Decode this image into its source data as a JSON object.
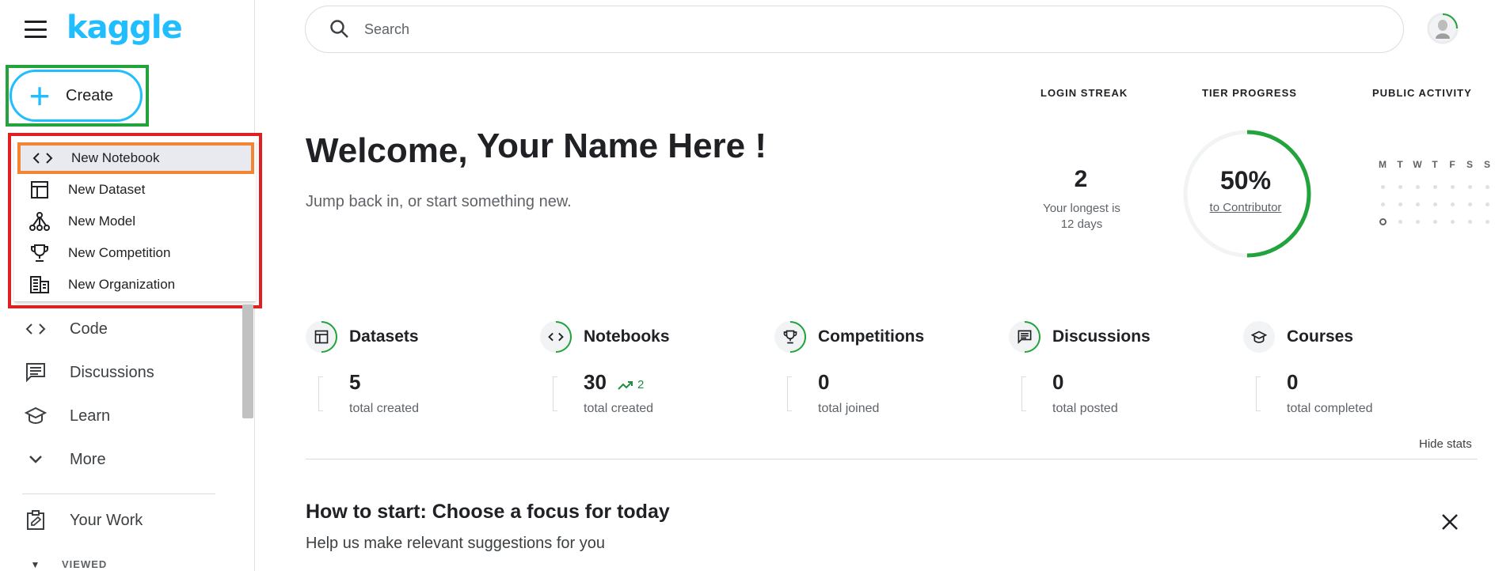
{
  "logo": "kaggle",
  "create_label": "Create",
  "create_menu": [
    {
      "label": "New Notebook",
      "icon": "code-icon"
    },
    {
      "label": "New Dataset",
      "icon": "table-icon"
    },
    {
      "label": "New Model",
      "icon": "model-icon"
    },
    {
      "label": "New Competition",
      "icon": "trophy-icon"
    },
    {
      "label": "New Organization",
      "icon": "building-icon"
    }
  ],
  "nav": [
    {
      "label": "Code",
      "icon": "code-icon"
    },
    {
      "label": "Discussions",
      "icon": "comment-icon"
    },
    {
      "label": "Learn",
      "icon": "school-icon"
    },
    {
      "label": "More",
      "icon": "chevron-down-icon"
    },
    {
      "label": "Your Work",
      "icon": "clipboard-edit-icon"
    }
  ],
  "viewed_label": "VIEWED",
  "search": {
    "placeholder": "Search"
  },
  "welcome": {
    "prefix": "Welcome,",
    "name": "Your Name Here !",
    "subtitle": "Jump back in, or start something new."
  },
  "login_streak": {
    "label": "LOGIN STREAK",
    "value": "2",
    "sub_line1": "Your longest is",
    "sub_line2": "12 days"
  },
  "tier_progress": {
    "label": "TIER PROGRESS",
    "percent": "50%",
    "target": "to Contributor",
    "fraction": 0.5
  },
  "public_activity": {
    "label": "PUBLIC ACTIVITY",
    "days": [
      "M",
      "T",
      "W",
      "T",
      "F",
      "S",
      "S"
    ]
  },
  "stats": [
    {
      "title": "Datasets",
      "value": "5",
      "sub": "total created",
      "icon": "table-icon"
    },
    {
      "title": "Notebooks",
      "value": "30",
      "trend": "2",
      "sub": "total created",
      "icon": "code-icon"
    },
    {
      "title": "Competitions",
      "value": "0",
      "sub": "total joined",
      "icon": "trophy-icon"
    },
    {
      "title": "Discussions",
      "value": "0",
      "sub": "total posted",
      "icon": "comment-icon"
    },
    {
      "title": "Courses",
      "value": "0",
      "sub": "total completed",
      "icon": "school-icon"
    }
  ],
  "hide_stats": "Hide stats",
  "howto": {
    "title": "How to start: Choose a focus for today",
    "subtitle": "Help us make relevant suggestions for you"
  },
  "colors": {
    "accent": "#20beff",
    "green": "#1e8e3e",
    "highlight_create": "#22a33b",
    "highlight_menu": "#e02020",
    "highlight_item": "#f28432"
  }
}
